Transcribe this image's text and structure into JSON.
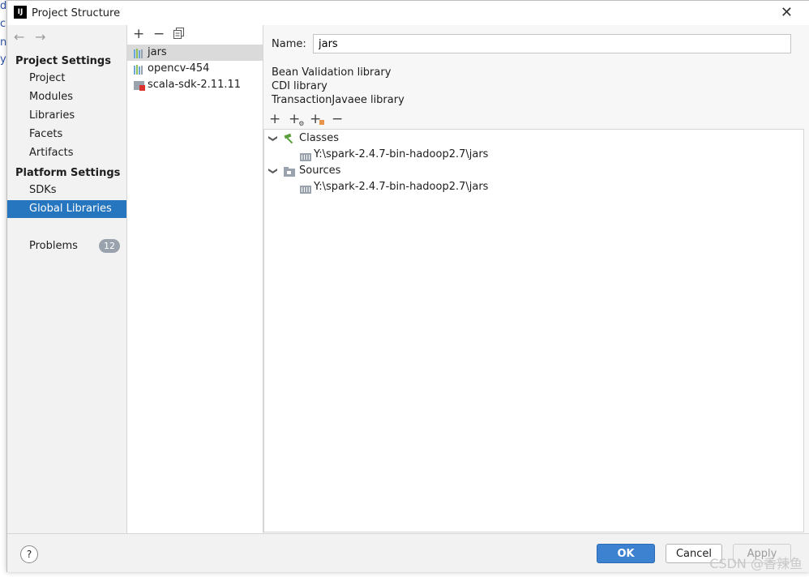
{
  "window": {
    "title": "Project Structure",
    "app_icon": "IJ"
  },
  "nav": {
    "project_settings_header": "Project Settings",
    "platform_settings_header": "Platform Settings",
    "items": [
      {
        "label": "Project"
      },
      {
        "label": "Modules"
      },
      {
        "label": "Libraries"
      },
      {
        "label": "Facets"
      },
      {
        "label": "Artifacts"
      },
      {
        "label": "SDKs"
      },
      {
        "label": "Global Libraries",
        "selected": true
      },
      {
        "label": "Problems",
        "badge": "12"
      }
    ]
  },
  "libraries": [
    {
      "label": "jars",
      "icon": "library-icon",
      "selected": true
    },
    {
      "label": "opencv-454",
      "icon": "library-icon"
    },
    {
      "label": "scala-sdk-2.11.11",
      "icon": "scala-sdk-icon"
    }
  ],
  "detail": {
    "name_label": "Name:",
    "name_value": "jars",
    "used_in": [
      "Bean Validation library",
      "CDI library",
      "TransactionJavaee library"
    ],
    "tree": {
      "classes_label": "Classes",
      "classes_path": "Y:\\spark-2.4.7-bin-hadoop2.7\\jars",
      "sources_label": "Sources",
      "sources_path": "Y:\\spark-2.4.7-bin-hadoop2.7\\jars"
    }
  },
  "footer": {
    "help": "?",
    "ok": "OK",
    "cancel": "Cancel",
    "apply": "Apply"
  },
  "watermark": "CSDN @香辣鱼",
  "colors": {
    "selection": "#2675bf",
    "ok_button": "#3d82d0",
    "badge": "#9aa3ad"
  }
}
